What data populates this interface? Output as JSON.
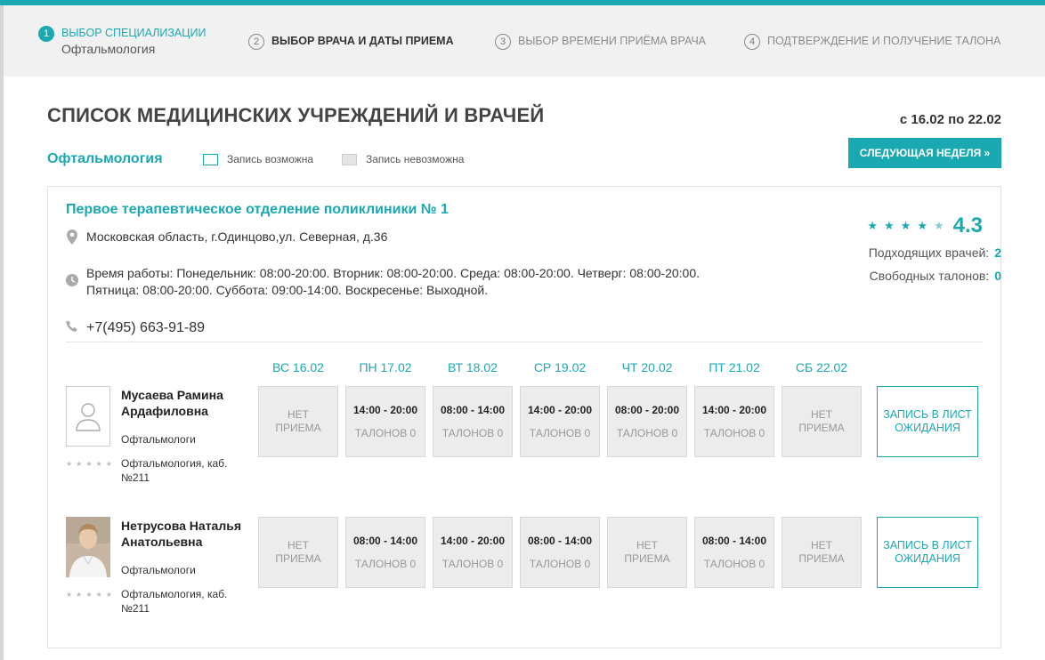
{
  "steps": [
    {
      "num": "1",
      "label": "Выбор специализации",
      "sub": "Офтальмология"
    },
    {
      "num": "2",
      "label": "Выбор врача и даты приема"
    },
    {
      "num": "3",
      "label": "Выбор времени приёма врача"
    },
    {
      "num": "4",
      "label": "Подтверждение и получение талона"
    }
  ],
  "page": {
    "title": "СПИСОК МЕДИЦИНСКИХ УЧРЕЖДЕНИЙ И ВРАЧЕЙ",
    "date_range": "с 16.02 по 22.02",
    "next_week_label": "СЛЕДУЮЩАЯ НЕДЕЛЯ »",
    "specialization": "Офтальмология"
  },
  "legend": {
    "possible": "Запись возможна",
    "impossible": "Запись невозможна"
  },
  "clinic": {
    "name": "Первое терапевтическое отделение поликлиники № 1",
    "address": "Московская область, г.Одинцово,ул. Северная, д.36",
    "hours_line1": "Время работы: Понедельник: 08:00-20:00. Вторник: 08:00-20:00. Среда: 08:00-20:00. Четверг: 08:00-20:00.",
    "hours_line2": "Пятница: 08:00-20:00. Суббота: 09:00-14:00. Воскресенье: Выходной.",
    "phone": "+7(495) 663-91-89",
    "rating": "4.3",
    "rating_stars": 4.3,
    "doctors_label": "Подходящих врачей:",
    "doctors_count": "2",
    "tickets_label": "Свободных талонов:",
    "tickets_count": "0"
  },
  "days": [
    "ВС 16.02",
    "ПН 17.02",
    "ВТ 18.02",
    "СР 19.02",
    "ЧТ 20.02",
    "ПТ 21.02",
    "СБ 22.02"
  ],
  "doctors": [
    {
      "name": "Мусаева Рамина Ардафиловна",
      "spec": "Офтальмологи",
      "cabinet": "Офтальмология, каб. №211",
      "waitlist_label": "ЗАПИСЬ В ЛИСТ ОЖИДАНИЯ",
      "slots": [
        {
          "l1": "НЕТ",
          "l2": "ПРИЕМА"
        },
        {
          "time": "14:00 - 20:00",
          "tickets": "ТАЛОНОВ 0"
        },
        {
          "time": "08:00 - 14:00",
          "tickets": "ТАЛОНОВ 0"
        },
        {
          "time": "14:00 - 20:00",
          "tickets": "ТАЛОНОВ 0"
        },
        {
          "time": "08:00 - 20:00",
          "tickets": "ТАЛОНОВ 0"
        },
        {
          "time": "14:00 - 20:00",
          "tickets": "ТАЛОНОВ 0"
        },
        {
          "l1": "НЕТ",
          "l2": "ПРИЕМА"
        }
      ]
    },
    {
      "name": "Нетрусова Наталья Анатольевна",
      "spec": "Офтальмологи",
      "cabinet": "Офтальмология, каб. №211",
      "waitlist_label": "ЗАПИСЬ В ЛИСТ ОЖИДАНИЯ",
      "slots": [
        {
          "l1": "НЕТ",
          "l2": "ПРИЕМА"
        },
        {
          "time": "08:00 - 14:00",
          "tickets": "ТАЛОНОВ 0"
        },
        {
          "time": "14:00 - 20:00",
          "tickets": "ТАЛОНОВ 0"
        },
        {
          "time": "08:00 - 14:00",
          "tickets": "ТАЛОНОВ 0"
        },
        {
          "l1": "НЕТ",
          "l2": "ПРИЕМА"
        },
        {
          "time": "08:00 - 14:00",
          "tickets": "ТАЛОНОВ 0"
        },
        {
          "l1": "НЕТ",
          "l2": "ПРИЕМА"
        }
      ]
    }
  ],
  "colors": {
    "accent": "#1ba9b1",
    "slot_bg": "#ececec"
  }
}
